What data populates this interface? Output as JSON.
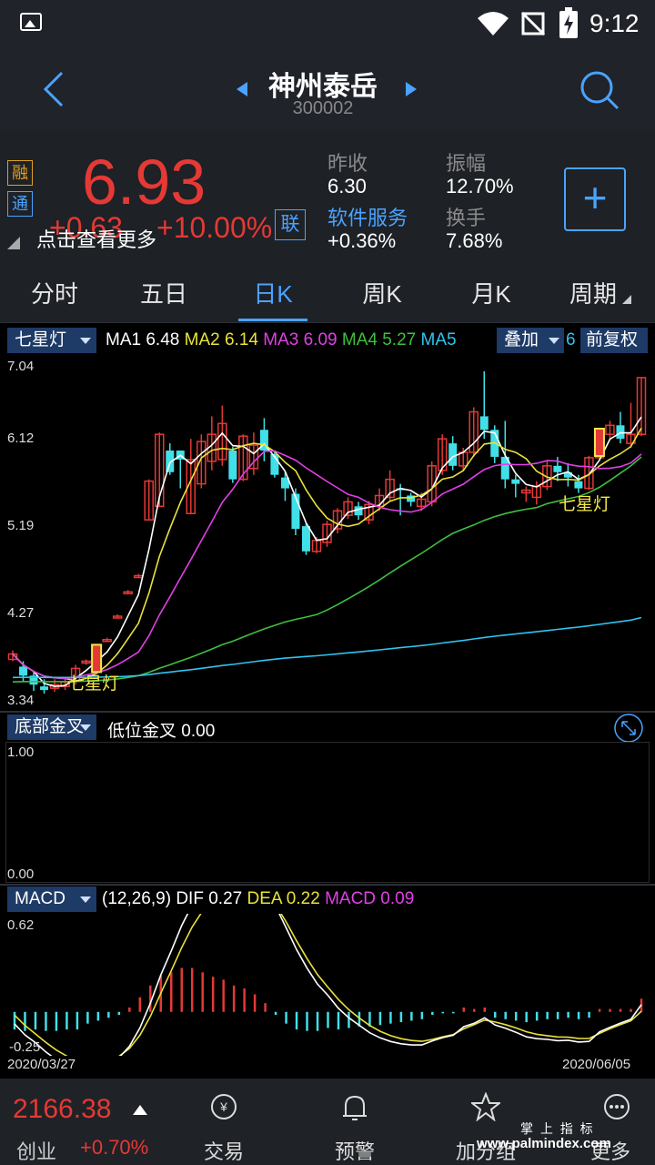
{
  "status": {
    "time": "9:12"
  },
  "header": {
    "name": "神州泰岳",
    "code": "300002"
  },
  "quote": {
    "price": "6.93",
    "change": "+0.63",
    "change_pct": "+10.00%",
    "tag1": "融",
    "tag2": "通",
    "tag3": "联",
    "hint": "点击查看更多",
    "prev_close_label": "昨收",
    "prev_close": "6.30",
    "amplitude_label": "振幅",
    "amplitude": "12.70%",
    "sector": "软件服务",
    "sector_pct": "+0.36%",
    "turnover_label": "换手",
    "turnover": "7.68%",
    "add_symbol": "+"
  },
  "tabs": [
    "分时",
    "五日",
    "日K",
    "周K",
    "月K",
    "周期"
  ],
  "main_chart": {
    "indicator": "七星灯",
    "overlay": "叠加",
    "overlay_num": "6",
    "adjust": "前复权",
    "ma": [
      {
        "label": "MA1",
        "value": "6.48",
        "color": "#ffffff"
      },
      {
        "label": "MA2",
        "value": "6.14",
        "color": "#e8e23a"
      },
      {
        "label": "MA3",
        "value": "6.09",
        "color": "#e040e6"
      },
      {
        "label": "MA4",
        "value": "5.27",
        "color": "#3fbf3f"
      },
      {
        "label": "MA5",
        "value": "",
        "color": "#2ec4f0"
      }
    ],
    "ticks": [
      "7.04",
      "6.12",
      "5.19",
      "4.27",
      "3.34"
    ],
    "marker1": "七星灯",
    "marker2": "七星灯"
  },
  "sub_chart": {
    "indicator": "底部金叉",
    "label": "低位金叉",
    "value": "0.00",
    "ticks": [
      "1.00",
      "0.00"
    ]
  },
  "macd_chart": {
    "indicator": "MACD",
    "params": "(12,26,9)",
    "dif_label": "DIF",
    "dif": "0.27",
    "dea_label": "DEA",
    "dea": "0.22",
    "macd_label": "MACD",
    "macd": "0.09",
    "ticks": [
      "0.62",
      "-0.25"
    ],
    "date_start": "2020/03/27",
    "date_end": "2020/06/05"
  },
  "chart_data": {
    "type": "candlestick",
    "ylim": [
      3.34,
      7.04
    ],
    "candles": [
      [
        3.8,
        3.86,
        3.78,
        3.9
      ],
      [
        3.72,
        3.62,
        3.55,
        3.78
      ],
      [
        3.62,
        3.52,
        3.45,
        3.66
      ],
      [
        3.5,
        3.46,
        3.42,
        3.58
      ],
      [
        3.48,
        3.52,
        3.44,
        3.58
      ],
      [
        3.5,
        3.55,
        3.46,
        3.6
      ],
      [
        3.56,
        3.7,
        3.52,
        3.74
      ],
      [
        3.76,
        3.78,
        3.74,
        3.8
      ],
      [
        3.85,
        3.85,
        3.82,
        3.87
      ],
      [
        4.02,
        4.02,
        4.0,
        4.04
      ],
      [
        4.28,
        4.28,
        4.26,
        4.3
      ],
      [
        4.55,
        4.55,
        4.53,
        4.57
      ],
      [
        4.73,
        4.73,
        4.71,
        4.75
      ],
      [
        5.35,
        5.78,
        5.35,
        5.8
      ],
      [
        5.5,
        6.3,
        5.5,
        6.32
      ],
      [
        6.12,
        5.88,
        5.85,
        6.2
      ],
      [
        6.12,
        6.02,
        5.7,
        6.12
      ],
      [
        5.42,
        6.02,
        5.42,
        6.25
      ],
      [
        5.75,
        6.22,
        5.7,
        6.3
      ],
      [
        6.0,
        6.3,
        5.9,
        6.5
      ],
      [
        6.02,
        6.42,
        5.95,
        6.62
      ],
      [
        6.12,
        5.8,
        5.76,
        6.16
      ],
      [
        5.8,
        6.28,
        5.78,
        6.3
      ],
      [
        5.92,
        6.18,
        5.85,
        6.32
      ],
      [
        6.35,
        6.12,
        6.0,
        6.48
      ],
      [
        6.08,
        5.85,
        5.82,
        6.1
      ],
      [
        5.82,
        5.7,
        5.56,
        5.88
      ],
      [
        5.64,
        5.25,
        5.18,
        5.7
      ],
      [
        5.28,
        5.0,
        4.96,
        5.32
      ],
      [
        5.0,
        5.12,
        4.98,
        5.16
      ],
      [
        5.1,
        5.3,
        5.05,
        5.34
      ],
      [
        5.25,
        5.45,
        5.2,
        5.48
      ],
      [
        5.4,
        5.55,
        5.36,
        5.6
      ],
      [
        5.5,
        5.4,
        5.35,
        5.55
      ],
      [
        5.35,
        5.52,
        5.3,
        5.56
      ],
      [
        5.5,
        5.62,
        5.45,
        5.7
      ],
      [
        5.6,
        5.8,
        5.56,
        5.9
      ],
      [
        5.7,
        5.68,
        5.4,
        5.75
      ],
      [
        5.62,
        5.55,
        5.5,
        5.65
      ],
      [
        5.5,
        5.58,
        5.45,
        5.65
      ],
      [
        5.55,
        5.95,
        5.5,
        6.0
      ],
      [
        5.9,
        6.25,
        5.85,
        6.3
      ],
      [
        6.2,
        5.95,
        5.9,
        6.28
      ],
      [
        5.95,
        6.1,
        5.9,
        6.15
      ],
      [
        6.1,
        6.55,
        6.05,
        6.6
      ],
      [
        6.5,
        6.35,
        6.25,
        7.0
      ],
      [
        6.35,
        6.05,
        5.98,
        6.4
      ],
      [
        6.05,
        5.8,
        5.7,
        6.45
      ],
      [
        5.8,
        5.75,
        5.6,
        5.85
      ],
      [
        5.65,
        5.68,
        5.55,
        5.72
      ],
      [
        5.6,
        5.72,
        5.52,
        5.78
      ],
      [
        5.72,
        5.95,
        5.68,
        6.0
      ],
      [
        5.95,
        5.88,
        5.78,
        6.05
      ],
      [
        5.88,
        5.82,
        5.72,
        5.98
      ],
      [
        5.78,
        5.7,
        5.65,
        5.85
      ],
      [
        5.7,
        6.04,
        5.68,
        6.06
      ],
      [
        6.04,
        6.3,
        6.02,
        6.34
      ],
      [
        6.3,
        6.4,
        6.25,
        6.45
      ],
      [
        6.4,
        6.25,
        6.2,
        6.55
      ],
      [
        6.2,
        6.3,
        6.15,
        6.65
      ],
      [
        6.3,
        6.93,
        6.28,
        6.93
      ]
    ],
    "macd_ylim": [
      -0.25,
      0.62
    ],
    "macd_hist": [
      -0.12,
      -0.13,
      -0.12,
      -0.13,
      -0.13,
      -0.12,
      -0.12,
      -0.08,
      -0.06,
      -0.04,
      -0.02,
      0.03,
      0.1,
      0.18,
      0.25,
      0.27,
      0.3,
      0.3,
      0.27,
      0.24,
      0.22,
      0.18,
      0.16,
      0.12,
      0.06,
      -0.02,
      -0.08,
      -0.12,
      -0.13,
      -0.13,
      -0.11,
      -0.12,
      -0.11,
      -0.1,
      -0.1,
      -0.09,
      -0.08,
      -0.07,
      -0.06,
      -0.05,
      -0.02,
      -0.01,
      -0.01,
      0.03,
      0.02,
      0.03,
      -0.04,
      -0.05,
      -0.06,
      -0.07,
      -0.06,
      -0.05,
      -0.05,
      -0.04,
      -0.05,
      -0.04,
      0.02,
      0.02,
      0.02,
      0.02,
      0.09
    ]
  },
  "footer": {
    "index_value": "2166.38",
    "index_name": "创业",
    "index_pct": "+0.70%",
    "trade": "交易",
    "alert": "预警",
    "group": "加分组",
    "more": "更多",
    "watermark1": "掌 上 指 标",
    "watermark2": "www.palmindex.com"
  },
  "colors": {
    "up": "#e53935",
    "down": "#41e0e8",
    "accent": "#4aa3ff"
  }
}
